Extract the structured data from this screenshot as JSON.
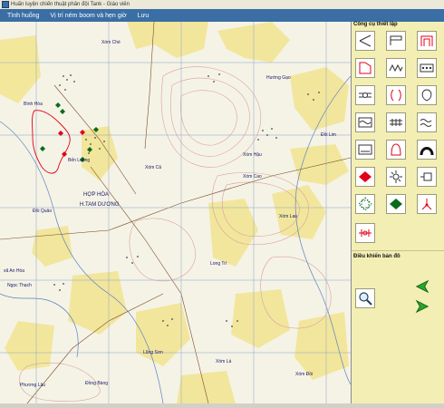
{
  "window": {
    "title": "Huấn luyện chiến thuật phân đội Tank - Giáo viên"
  },
  "menu": [
    {
      "label": "Tình huống"
    },
    {
      "label": "Vị trí ném boom và hẹn giờ"
    },
    {
      "label": "Lưu"
    }
  ],
  "panel": {
    "tools_title": "Công cụ thiết lập",
    "map_controls_title": "Điều khiển bản đồ",
    "tools": [
      {
        "icon": "triangle-flag-icon"
      },
      {
        "icon": "flag-icon"
      },
      {
        "icon": "gate-red-icon"
      },
      {
        "icon": "corner-flag-red-icon"
      },
      {
        "icon": "zigzag-icon"
      },
      {
        "icon": "dots-box-icon"
      },
      {
        "icon": "line-circles-icon"
      },
      {
        "icon": "brackets-red-icon"
      },
      {
        "icon": "loop-icon"
      },
      {
        "icon": "wave-box-icon"
      },
      {
        "icon": "ladder-icon"
      },
      {
        "icon": "double-wave-icon"
      },
      {
        "icon": "box-line-icon"
      },
      {
        "icon": "bell-red-icon"
      },
      {
        "icon": "arch-icon"
      },
      {
        "icon": "red-diamond-icon"
      },
      {
        "icon": "gear-unit-icon"
      },
      {
        "icon": "bracket-box-icon"
      },
      {
        "icon": "dotted-square-icon"
      },
      {
        "icon": "green-diamond-icon"
      },
      {
        "icon": "tripod-red-icon"
      },
      {
        "icon": "crossed-line-red-icon"
      }
    ],
    "controls": [
      {
        "icon": "zoom-icon"
      },
      {
        "icon": "arrow-left-icon"
      },
      {
        "icon": "arrow-right-icon"
      }
    ]
  },
  "map": {
    "labels": [
      {
        "text": "Bình Hòa"
      },
      {
        "text": "Bến Luông"
      },
      {
        "text": "HỢP HÒA"
      },
      {
        "text": "H.TAM DƯƠNG"
      },
      {
        "text": "Đồi Quảo"
      },
      {
        "text": "Xóm Cao"
      },
      {
        "text": "Xóm Hậu"
      },
      {
        "text": "Hướng Gạo"
      },
      {
        "text": "Long Trì"
      },
      {
        "text": "Lũng Sơn"
      },
      {
        "text": "Xóm Lá"
      },
      {
        "text": "xã An Hòa"
      },
      {
        "text": "Ngọc Thạch"
      },
      {
        "text": "Xóm Lau"
      },
      {
        "text": "Xóm Chè"
      },
      {
        "text": "Phương Lâu"
      },
      {
        "text": "Đồi Lim"
      },
      {
        "text": "Xóm Cả"
      },
      {
        "text": "Đồng Bàng"
      },
      {
        "text": "Xóm Đồi"
      }
    ]
  },
  "colors": {
    "menubar": "#3a6ea5",
    "panel": "#f3efb4",
    "map_bg": "#f5f3e6",
    "grid": "#8aa3c8",
    "red": "#e0001a",
    "green": "#0a6b1a"
  }
}
